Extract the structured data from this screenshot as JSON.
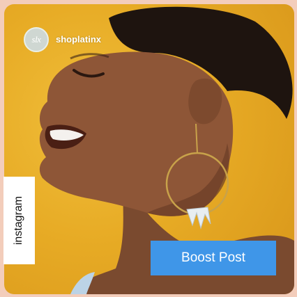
{
  "post": {
    "avatar_initials": "slx",
    "username": "shoplatinx",
    "platform_label": "instagram",
    "boost_button_label": "Boost Post"
  },
  "colors": {
    "background": "#f3cdbb",
    "photo_backdrop": "#e7ab25",
    "boost_button": "#3f96e8"
  }
}
